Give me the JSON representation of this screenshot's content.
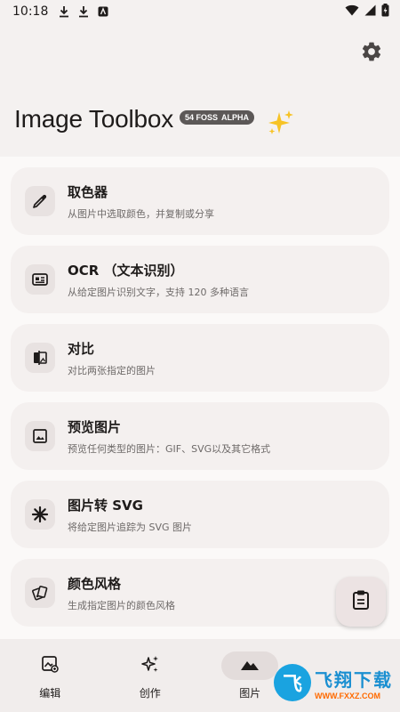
{
  "status_bar": {
    "time": "10:18"
  },
  "header": {
    "title": "Image Toolbox",
    "badge_version": "54 FOSS",
    "badge_channel": "ALPHA"
  },
  "tools": [
    {
      "title": "取色器",
      "subtitle": "从图片中选取颜色，并复制或分享",
      "icon": "eyedropper-icon"
    },
    {
      "title": "OCR （文本识别）",
      "subtitle": "从给定图片识别文字，支持 120 多种语言",
      "icon": "ocr-icon"
    },
    {
      "title": "对比",
      "subtitle": "对比两张指定的图片",
      "icon": "compare-icon"
    },
    {
      "title": "预览图片",
      "subtitle": "预览任何类型的图片：GIF、SVG以及其它格式",
      "icon": "image-preview-icon"
    },
    {
      "title": "图片转 SVG",
      "subtitle": "将给定图片追踪为 SVG 图片",
      "icon": "svg-trace-icon"
    },
    {
      "title": "颜色风格",
      "subtitle": "生成指定图片的颜色风格",
      "icon": "palette-icon"
    }
  ],
  "bottom_nav": [
    {
      "label": "编辑",
      "icon": "edit-image-icon"
    },
    {
      "label": "创作",
      "icon": "sparkle-create-icon"
    },
    {
      "label": "图片",
      "icon": "image-mountain-icon"
    }
  ],
  "watermark": {
    "logo": "飞",
    "name": "飞翔下载",
    "url": "WWW.FXXZ.COM"
  },
  "colors": {
    "background": "#fbf9f8",
    "card": "#f4f0ef",
    "icon_box": "#e8e2e1",
    "badge": "#5c5857"
  }
}
